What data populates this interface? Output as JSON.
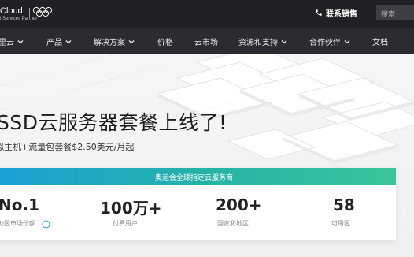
{
  "header": {
    "logo_text": "Cloud",
    "logo_subtitle": "l Services Partner",
    "contact_sales": "联系销售",
    "search_placeholder": "搜索"
  },
  "nav": {
    "items": [
      {
        "label": "里云",
        "dropdown": true
      },
      {
        "label": "产品",
        "dropdown": true
      },
      {
        "label": "解决方案",
        "dropdown": true
      },
      {
        "label": "价格",
        "dropdown": false
      },
      {
        "label": "云市场",
        "dropdown": false
      },
      {
        "label": "资源和支持",
        "dropdown": true
      },
      {
        "label": "合作伙伴",
        "dropdown": true
      },
      {
        "label": "文档",
        "dropdown": false
      }
    ]
  },
  "hero": {
    "headline": "SSD云服务器套餐上线了!",
    "subline": "拟主机+流量包套餐$2.50美元/月起"
  },
  "stats": {
    "banner": "奥运会全球指定云服务商",
    "items": [
      {
        "value": "No.1",
        "label": "地区市场份额",
        "info_icon": true
      },
      {
        "value": "100万+",
        "label": "付费用户"
      },
      {
        "value": "200+",
        "label": "国家和地区"
      },
      {
        "value": "58",
        "label": "可用区"
      }
    ]
  },
  "colors": {
    "topbar": "#1f2125",
    "navbar": "#2a2c31",
    "banner_gradient_start": "#1aa0d8",
    "banner_gradient_end": "#3bc49b",
    "info_icon": "#1a9ad8"
  },
  "icons": [
    "olympic-rings-icon",
    "phone-icon",
    "chevron-down-icon",
    "info-icon"
  ]
}
